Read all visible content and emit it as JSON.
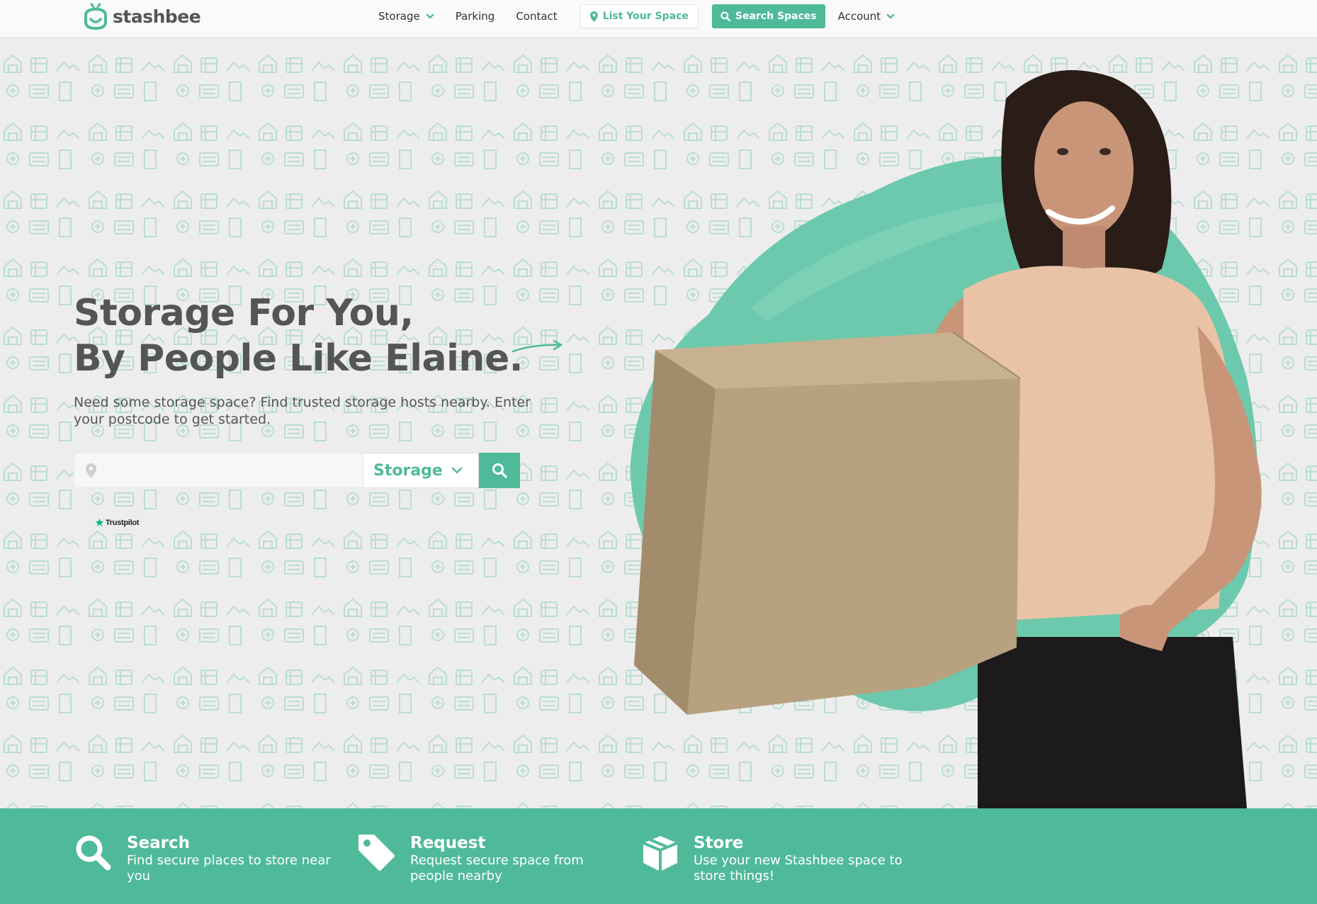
{
  "brand": {
    "name": "stashbee",
    "logo_icon": "bee-logo-icon"
  },
  "nav": {
    "storage_label": "Storage",
    "parking_label": "Parking",
    "contact_label": "Contact",
    "list_space_label": "List Your Space",
    "search_spaces_label": "Search Spaces",
    "account_label": "Account"
  },
  "hero": {
    "headline_line1": "Storage For You,",
    "headline_line2": "By People Like Elaine.",
    "subtitle": "Need some storage space? Find trusted storage hosts nearby. Enter your postcode to get started.",
    "postcode_placeholder": "",
    "type_select_value": "Storage",
    "trustpilot_label": "Trustpilot"
  },
  "steps": [
    {
      "title": "Search",
      "description": "Find secure places to store near you",
      "icon": "search-icon"
    },
    {
      "title": "Request",
      "description": "Request secure space from people nearby",
      "icon": "tag-icon"
    },
    {
      "title": "Store",
      "description": "Use your new Stashbee space to store things!",
      "icon": "box-icon"
    }
  ],
  "colors": {
    "accent": "#4fba9a",
    "text": "#555555",
    "background": "#ededed"
  }
}
